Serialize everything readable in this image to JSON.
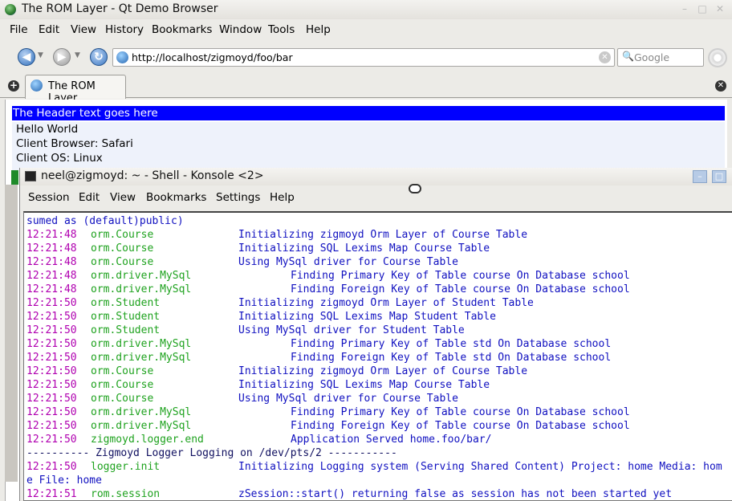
{
  "browser": {
    "title": "The ROM Layer - Qt Demo Browser",
    "window_buttons": [
      "–",
      "□",
      "✕"
    ],
    "menu": [
      "File",
      "Edit",
      "View",
      "History",
      "Bookmarks",
      "Window",
      "Tools",
      "Help"
    ],
    "nav": {
      "back_glyph": "◀",
      "forward_glyph": "▶",
      "reload_glyph": "↻",
      "dropdown_glyph": "▼",
      "url": "http://localhost/zigmoyd/foo/bar",
      "clear_glyph": "✕",
      "search_icon": "🔍",
      "search_placeholder": "Google"
    },
    "tabs": [
      {
        "label": "The ROM Layer"
      }
    ],
    "new_tab_glyph": "+",
    "close_tab_glyph": "✕",
    "page": {
      "header": "The Header text goes here",
      "lines": [
        "Hello World",
        "Client Browser: Safari",
        "Client OS: Linux"
      ]
    }
  },
  "konsole": {
    "title": "neel@zigmoyd: ~ - Shell - Konsole <2>",
    "window_buttons": [
      "–",
      "□"
    ],
    "menu": [
      "Session",
      "Edit",
      "View",
      "Bookmarks",
      "Settings",
      "Help"
    ],
    "lines": [
      {
        "type": "plain",
        "text": "sumed as (default)public)"
      },
      {
        "type": "log",
        "time": "12:21:48",
        "module": "orm.Course",
        "indent": 0,
        "message": "Initializing zigmoyd Orm Layer of Course Table"
      },
      {
        "type": "log",
        "time": "12:21:48",
        "module": "orm.Course",
        "indent": 0,
        "message": "Initializing SQL Lexims Map Course Table"
      },
      {
        "type": "log",
        "time": "12:21:48",
        "module": "orm.Course",
        "indent": 0,
        "message": "Using MySql driver for Course Table"
      },
      {
        "type": "log",
        "time": "12:21:48",
        "module": "orm.driver.MySql",
        "indent": 1,
        "message": "Finding Primary Key of Table course On Database school"
      },
      {
        "type": "log",
        "time": "12:21:48",
        "module": "orm.driver.MySql",
        "indent": 1,
        "message": "Finding Foreign Key of Table course On Database school"
      },
      {
        "type": "log",
        "time": "12:21:50",
        "module": "orm.Student",
        "indent": 0,
        "message": "Initializing zigmoyd Orm Layer of Student Table"
      },
      {
        "type": "log",
        "time": "12:21:50",
        "module": "orm.Student",
        "indent": 0,
        "message": "Initializing SQL Lexims Map Student Table"
      },
      {
        "type": "log",
        "time": "12:21:50",
        "module": "orm.Student",
        "indent": 0,
        "message": "Using MySql driver for Student Table"
      },
      {
        "type": "log",
        "time": "12:21:50",
        "module": "orm.driver.MySql",
        "indent": 1,
        "message": "Finding Primary Key of Table std On Database school"
      },
      {
        "type": "log",
        "time": "12:21:50",
        "module": "orm.driver.MySql",
        "indent": 1,
        "message": "Finding Foreign Key of Table std On Database school"
      },
      {
        "type": "log",
        "time": "12:21:50",
        "module": "orm.Course",
        "indent": 0,
        "message": "Initializing zigmoyd Orm Layer of Course Table"
      },
      {
        "type": "log",
        "time": "12:21:50",
        "module": "orm.Course",
        "indent": 0,
        "message": "Initializing SQL Lexims Map Course Table"
      },
      {
        "type": "log",
        "time": "12:21:50",
        "module": "orm.Course",
        "indent": 0,
        "message": "Using MySql driver for Course Table"
      },
      {
        "type": "log",
        "time": "12:21:50",
        "module": "orm.driver.MySql",
        "indent": 1,
        "message": "Finding Primary Key of Table course On Database school"
      },
      {
        "type": "log",
        "time": "12:21:50",
        "module": "orm.driver.MySql",
        "indent": 1,
        "message": "Finding Foreign Key of Table course On Database school"
      },
      {
        "type": "log",
        "time": "12:21:50",
        "module": "zigmoyd.logger.end",
        "indent": 1,
        "message": "Application Served home.foo/bar/"
      },
      {
        "type": "sep",
        "text": "---------- Zigmoyd Logger Logging on /dev/pts/2 -----------"
      },
      {
        "type": "log",
        "time": "12:21:50",
        "module": "logger.init",
        "indent": 0,
        "message": "Initializing Logging system (Serving Shared Content) Project: home Media: hom"
      },
      {
        "type": "plain",
        "text": "e File: home"
      },
      {
        "type": "log",
        "time": "12:21:51",
        "module": "rom.session",
        "indent": 0,
        "message": "zSession::start() returning false as session has not been started yet"
      }
    ]
  }
}
